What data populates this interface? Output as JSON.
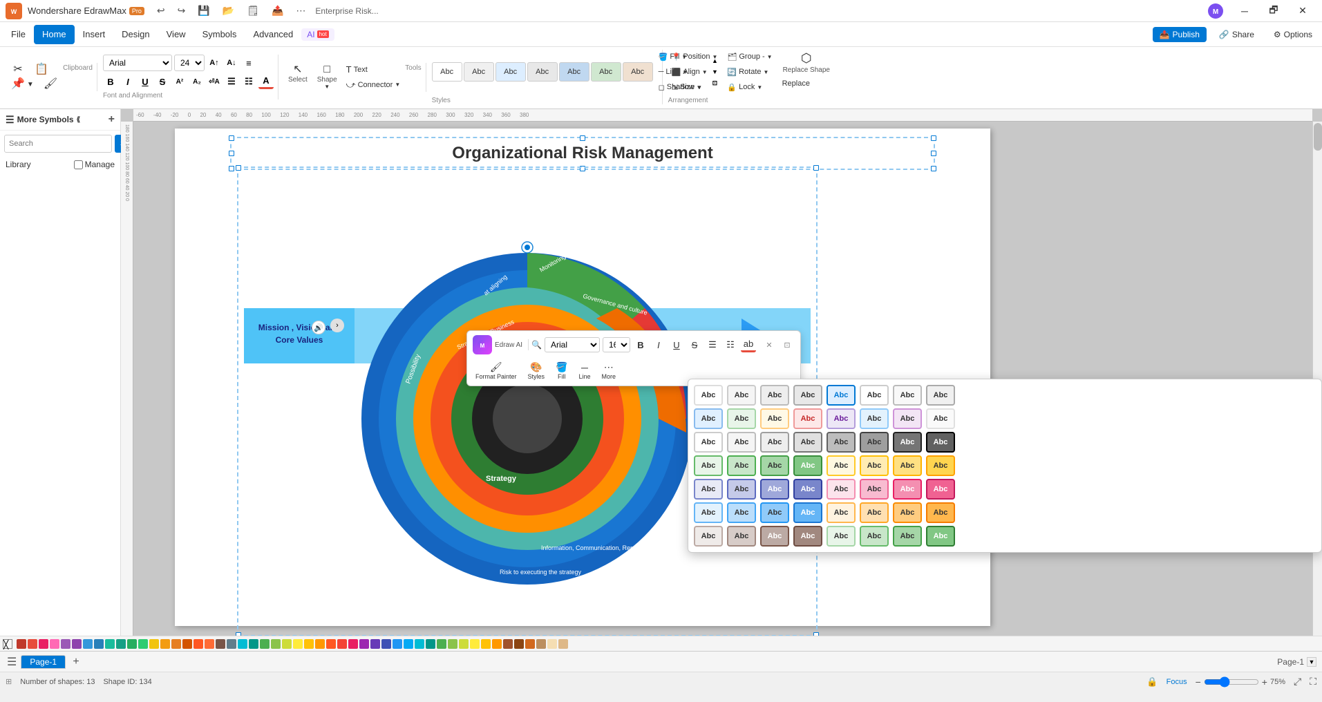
{
  "app": {
    "name": "Wondershare EdrawMax",
    "tier": "Pro",
    "title": "Enterprise Risk..."
  },
  "titlebar": {
    "undo": "↩",
    "redo": "↪",
    "save": "💾",
    "open": "📂",
    "template": "🗒",
    "export": "📤",
    "more": "⋯",
    "minimize": "─",
    "restore": "🗗",
    "close": "✕"
  },
  "menubar": {
    "items": [
      "File",
      "Home",
      "Insert",
      "Design",
      "View",
      "Symbols",
      "Advanced"
    ],
    "active": "Home",
    "ai_label": "AI",
    "ai_hot": "hot",
    "publish": "Publish",
    "share": "Share",
    "options": "Options"
  },
  "ribbon": {
    "clipboard": {
      "label": "Clipboard",
      "cut": "✂",
      "copy": "📋",
      "paste": "📌",
      "format_paint": "🖌"
    },
    "font": {
      "label": "Font and Alignment",
      "name": "Arial",
      "size": "24",
      "bold": "B",
      "italic": "I",
      "underline": "U",
      "strikethrough": "S",
      "superscript": "A²",
      "subscript": "A₂",
      "align_left": "≡",
      "align_center": "≡",
      "align_right": "≡",
      "bullets": "☰",
      "numbering": "☷",
      "font_color": "A",
      "increase": "A↑",
      "decrease": "A↓"
    },
    "tools": {
      "label": "Tools",
      "select": "Select",
      "select_icon": "↖",
      "shape": "Shape",
      "shape_icon": "□",
      "text": "Text",
      "text_icon": "T",
      "connector": "Connector",
      "connector_icon": "⤻"
    },
    "styles": {
      "label": "Styles",
      "fill": "Fill",
      "line": "Line",
      "shadow": "Shadow",
      "expand": "▼"
    },
    "arrangement": {
      "label": "Arrangement",
      "position": "Position",
      "group": "Group -",
      "rotate": "Rotate",
      "size": "Size",
      "lock": "Lock",
      "align": "Align",
      "replace_shape": "Replace Shape",
      "replace": "Replace"
    }
  },
  "style_boxes": [
    {
      "label": "Abc",
      "border": "#cccccc",
      "bg": "#ffffff"
    },
    {
      "label": "Abc",
      "border": "#bbbbbb",
      "bg": "#f0f0f0"
    },
    {
      "label": "Abc",
      "border": "#999999",
      "bg": "#e0e0e0"
    },
    {
      "label": "Abc",
      "border": "#777777",
      "bg": "#d0d0d0"
    },
    {
      "label": "Abc",
      "border": "#555555",
      "bg": "#c0c0c0"
    },
    {
      "label": "Abc",
      "border": "#333333",
      "bg": "#b0b0b0"
    },
    {
      "label": "Abc",
      "border": "#111111",
      "bg": "#a0a0a0"
    }
  ],
  "left_panel": {
    "title": "More Symbols",
    "search_placeholder": "Search",
    "search_btn": "Search",
    "library": "Library",
    "manage": "Manage"
  },
  "canvas": {
    "diagram_title": "Organizational Risk Management",
    "zoom": "75%",
    "shape_count": "Number of shapes: 13",
    "shape_id": "Shape ID: 134",
    "focus": "Focus"
  },
  "float_toolbar": {
    "font": "Arial",
    "size": "16",
    "format_painter": "Format Painter",
    "styles_label": "Styles",
    "fill_label": "Fill",
    "line_label": "Line",
    "more_label": "More"
  },
  "styles_popup": {
    "rows": 7,
    "cols": 8,
    "boxes": [
      {
        "label": "Abc",
        "bg": "#ffffff",
        "border": "#dddddd"
      },
      {
        "label": "Abc",
        "bg": "#f5f5f5",
        "border": "#cccccc"
      },
      {
        "label": "Abc",
        "bg": "#eeeeee",
        "border": "#bbbbbb"
      },
      {
        "label": "Abc",
        "bg": "#e8e8e8",
        "border": "#aaaaaa"
      },
      {
        "label": "Abc",
        "bg": "#ddeeff",
        "border": "#0078d4",
        "color": "#0078d4"
      },
      {
        "label": "Abc",
        "bg": "#ffffff",
        "border": "#cccccc"
      },
      {
        "label": "Abc",
        "bg": "#f8f8f8",
        "border": "#bbbbbb"
      },
      {
        "label": "Abc",
        "bg": "#f0f0f0",
        "border": "#aaaaaa"
      },
      {
        "label": "Abc",
        "bg": "#e0f0ff",
        "border": "#88bbee"
      },
      {
        "label": "Abc",
        "bg": "#e8f5e9",
        "border": "#a5d6a7"
      },
      {
        "label": "Abc",
        "bg": "#fff9e6",
        "border": "#ffcc80"
      },
      {
        "label": "Abc",
        "bg": "#fde8e8",
        "border": "#ef9a9a",
        "color": "#c62828"
      },
      {
        "label": "Abc",
        "bg": "#ede7f6",
        "border": "#b39ddb",
        "color": "#6a1b9a"
      },
      {
        "label": "Abc",
        "bg": "#e3f2fd",
        "border": "#90caf9"
      },
      {
        "label": "Abc",
        "bg": "#f3e5f5",
        "border": "#ce93d8"
      },
      {
        "label": "Abc",
        "bg": "#fafafa",
        "border": "#e0e0e0"
      },
      {
        "label": "Abc",
        "bg": "#ffffff",
        "border": "#cccccc"
      },
      {
        "label": "Abc",
        "bg": "#f5f5f5",
        "border": "#bdbdbd"
      },
      {
        "label": "Abc",
        "bg": "#eeeeee",
        "border": "#9e9e9e"
      },
      {
        "label": "Abc",
        "bg": "#e0e0e0",
        "border": "#757575"
      },
      {
        "label": "Abc",
        "bg": "#bdbdbd",
        "border": "#616161"
      },
      {
        "label": "Abc",
        "bg": "#9e9e9e",
        "border": "#424242"
      },
      {
        "label": "Abc",
        "bg": "#757575",
        "border": "#212121",
        "color": "#fff"
      },
      {
        "label": "Abc",
        "bg": "#616161",
        "border": "#000000",
        "color": "#fff"
      },
      {
        "label": "Abc",
        "bg": "#e8f5e9",
        "border": "#66bb6a"
      },
      {
        "label": "Abc",
        "bg": "#c8e6c9",
        "border": "#4caf50"
      },
      {
        "label": "Abc",
        "bg": "#a5d6a7",
        "border": "#43a047"
      },
      {
        "label": "Abc",
        "bg": "#81c784",
        "border": "#388e3c",
        "color": "#fff"
      },
      {
        "label": "Abc",
        "bg": "#fff8e1",
        "border": "#ffca28"
      },
      {
        "label": "Abc",
        "bg": "#ffecb3",
        "border": "#ffc107"
      },
      {
        "label": "Abc",
        "bg": "#ffe082",
        "border": "#ffb300"
      },
      {
        "label": "Abc",
        "bg": "#ffd54f",
        "border": "#ffa000"
      },
      {
        "label": "Abc",
        "bg": "#e8eaf6",
        "border": "#7986cb"
      },
      {
        "label": "Abc",
        "bg": "#c5cae9",
        "border": "#5c6bc0"
      },
      {
        "label": "Abc",
        "bg": "#9fa8da",
        "border": "#3949ab",
        "color": "#fff"
      },
      {
        "label": "Abc",
        "bg": "#7986cb",
        "border": "#303f9f",
        "color": "#fff"
      },
      {
        "label": "Abc",
        "bg": "#fce4ec",
        "border": "#f48fb1"
      },
      {
        "label": "Abc",
        "bg": "#f8bbd0",
        "border": "#f06292"
      },
      {
        "label": "Abc",
        "bg": "#f48fb1",
        "border": "#e91e63",
        "color": "#fff"
      },
      {
        "label": "Abc",
        "bg": "#f06292",
        "border": "#c2185b",
        "color": "#fff"
      },
      {
        "label": "Abc",
        "bg": "#e3f2fd",
        "border": "#64b5f6"
      },
      {
        "label": "Abc",
        "bg": "#bbdefb",
        "border": "#42a5f5"
      },
      {
        "label": "Abc",
        "bg": "#90caf9",
        "border": "#2196f3"
      },
      {
        "label": "Abc",
        "bg": "#64b5f6",
        "border": "#1976d2",
        "color": "#fff"
      },
      {
        "label": "Abc",
        "bg": "#fff3e0",
        "border": "#ffb74d"
      },
      {
        "label": "Abc",
        "bg": "#ffe0b2",
        "border": "#ffa726"
      },
      {
        "label": "Abc",
        "bg": "#ffcc80",
        "border": "#fb8c00"
      },
      {
        "label": "Abc",
        "bg": "#ffb74d",
        "border": "#f57c00",
        "color": "#333"
      },
      {
        "label": "Abc",
        "bg": "#efebe9",
        "border": "#bcaaa4"
      },
      {
        "label": "Abc",
        "bg": "#d7ccc8",
        "border": "#a1887f"
      },
      {
        "label": "Abc",
        "bg": "#bcaaa4",
        "border": "#795548",
        "color": "#fff"
      },
      {
        "label": "Abc",
        "bg": "#a1887f",
        "border": "#6d4c41",
        "color": "#fff"
      },
      {
        "label": "Abc",
        "bg": "#e8f5e9",
        "border": "#a5d6a7"
      },
      {
        "label": "Abc",
        "bg": "#c8e6c9",
        "border": "#66bb6a"
      },
      {
        "label": "Abc",
        "bg": "#a5d6a7",
        "border": "#43a047"
      },
      {
        "label": "Abc",
        "bg": "#81c784",
        "border": "#2e7d32",
        "color": "#fff"
      }
    ]
  },
  "colors": [
    "#c0392b",
    "#e74c3c",
    "#e91e63",
    "#ff69b4",
    "#9b59b6",
    "#8e44ad",
    "#3498db",
    "#2980b9",
    "#1abc9c",
    "#16a085",
    "#27ae60",
    "#2ecc71",
    "#f1c40f",
    "#f39c12",
    "#e67e22",
    "#d35400",
    "#ff5722",
    "#ff6b35",
    "#795548",
    "#607d8b",
    "#00bcd4",
    "#009688",
    "#4caf50",
    "#8bc34a",
    "#cddc39",
    "#ffeb3b",
    "#ffc107",
    "#ff9800",
    "#ff5722",
    "#f44336",
    "#e91e63",
    "#9c27b0",
    "#673ab7",
    "#3f51b5",
    "#2196f3",
    "#03a9f4",
    "#00bcd4",
    "#009688",
    "#4caf50",
    "#8bc34a",
    "#cddc39",
    "#ffeb3b",
    "#ffc107",
    "#ff9800",
    "#a0522d",
    "#8b4513",
    "#d2691e",
    "#bc8f5f",
    "#f5deb3",
    "#deb887"
  ],
  "bottom": {
    "page_label": "Page-1",
    "active_page": "Page-1"
  },
  "statusbar": {
    "shapes_count": "Number of shapes: 13",
    "shape_id": "Shape ID: 134",
    "focus": "Focus",
    "zoom_value": "75%"
  }
}
